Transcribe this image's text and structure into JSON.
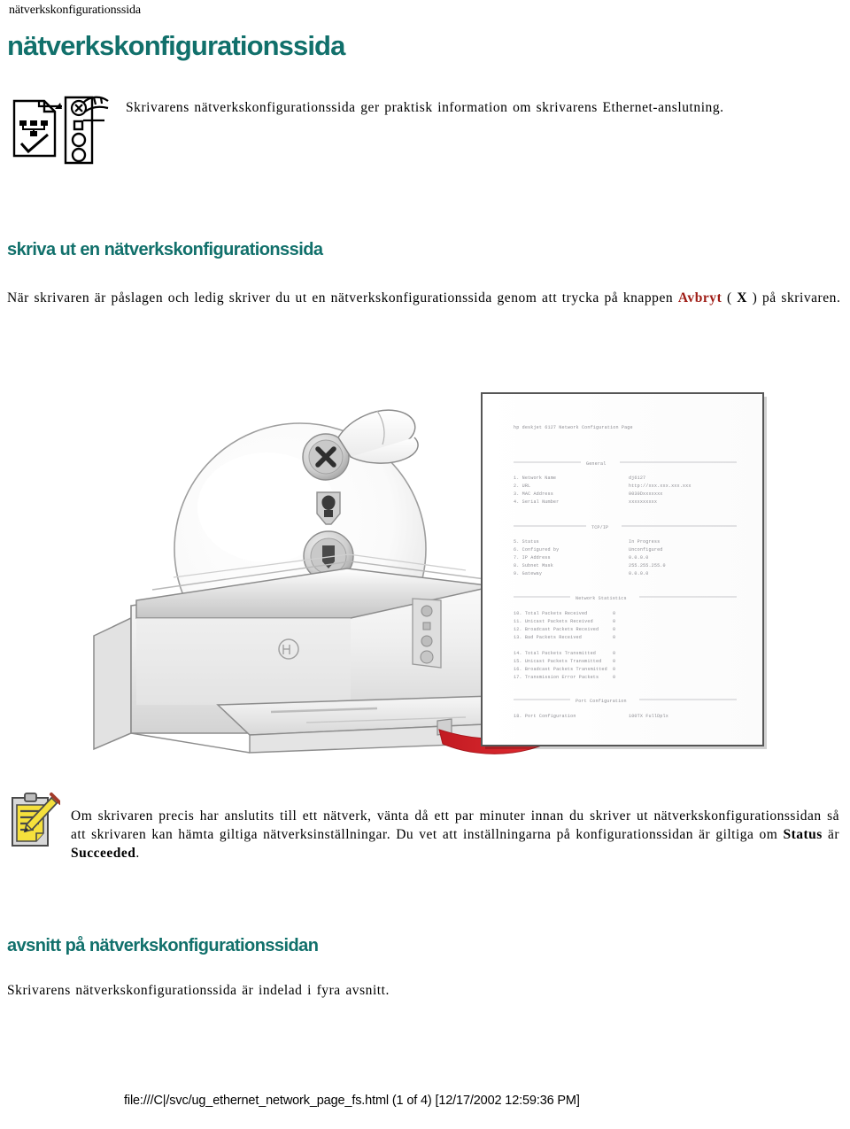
{
  "running_header": "nätverkskonfigurationssida",
  "doc_title": "nätverkskonfigurationssida",
  "intro": {
    "icon_name": "network-config-page-icon",
    "text": "Skrivarens nätverkskonfigurationssida ger praktisk information om skrivarens Ethernet-anslutning."
  },
  "print_section": {
    "heading": "skriva ut en nätverkskonfigurationssida",
    "text_part1": "När skrivaren är påslagen och ledig skriver du ut en nätverkskonfigurationssida genom att trycka på knappen ",
    "emphasis_button": "Avbryt",
    "text_part2": " ( ",
    "emphasis_symbol": "X",
    "text_part3": " ) på skrivaren."
  },
  "illustration": {
    "name": "printer-cancel-button-illustration",
    "callout_buttons": [
      {
        "name": "cancel-button",
        "glyph": "X",
        "label": "Avbryt"
      },
      {
        "name": "ink-status-icon",
        "glyph": "ink",
        "label": ""
      },
      {
        "name": "resume-button",
        "glyph": "page",
        "label": ""
      },
      {
        "name": "power-button",
        "glyph": "power",
        "label": ""
      }
    ],
    "arrow_color": "#d8262c",
    "printer_name": "hp deskjet printer"
  },
  "config_page": {
    "title": "hp deskjet 6127 Network Configuration Page",
    "sections": [
      {
        "name": "General",
        "rows": [
          {
            "num": "1.",
            "label": "Network Name",
            "value": "dj6127"
          },
          {
            "num": "2.",
            "label": "URL",
            "value": "http://xxx.xxx.xxx.xxx"
          },
          {
            "num": "3.",
            "label": "MAC Address",
            "value": "0030Dxxxxxxx"
          },
          {
            "num": "4.",
            "label": "Serial Number",
            "value": "xxxxxxxxxx"
          }
        ]
      },
      {
        "name": "TCP/IP",
        "rows": [
          {
            "num": "5.",
            "label": "Status",
            "value": "In Progress"
          },
          {
            "num": "6.",
            "label": "Configured by",
            "value": "Unconfigured"
          },
          {
            "num": "7.",
            "label": "IP Address",
            "value": "0.0.0.0"
          },
          {
            "num": "8.",
            "label": "Subnet Mask",
            "value": "255.255.255.0"
          },
          {
            "num": "9.",
            "label": "Gateway",
            "value": "0.0.0.0"
          }
        ]
      },
      {
        "name": "Network Statistics",
        "rows": [
          {
            "num": "10.",
            "label": "Total Packets Received",
            "value": "0"
          },
          {
            "num": "11.",
            "label": "Unicast Packets Received",
            "value": "0"
          },
          {
            "num": "12.",
            "label": "Broadcast Packets Received",
            "value": "0"
          },
          {
            "num": "13.",
            "label": "Bad Packets Received",
            "value": "0"
          },
          {
            "num": "14.",
            "label": "Total Packets Transmitted",
            "value": "0"
          },
          {
            "num": "15.",
            "label": "Unicast Packets Transmitted",
            "value": "0"
          },
          {
            "num": "16.",
            "label": "Broadcast Packets Transmitted",
            "value": "0"
          },
          {
            "num": "17.",
            "label": "Transmission Error Packets",
            "value": "0"
          }
        ]
      },
      {
        "name": "Port Configuration",
        "rows": [
          {
            "num": "18.",
            "label": "Port Configuration",
            "value": "100TX FullDplx"
          }
        ]
      }
    ]
  },
  "note": {
    "icon_name": "notepad-pencil-icon",
    "text_part1": "Om skrivaren precis har anslutits till ett nätverk, vänta då ett par minuter innan du skriver ut nätverkskonfigurationssidan så att skrivaren kan hämta giltiga nätverksinställningar. Du vet att inställningarna på konfigurationssidan är giltiga om ",
    "emphasis_status": "Status",
    "text_part2": " är ",
    "emphasis_succeeded": "Succeeded",
    "text_part3": "."
  },
  "parts_section": {
    "heading": "avsnitt på nätverkskonfigurationssidan",
    "text": "Skrivarens nätverkskonfigurationssida är indelad i fyra avsnitt."
  },
  "footer": "file:///C|/svc/ug_ethernet_network_page_fs.html (1 of 4) [12/17/2002 12:59:36 PM]",
  "colors": {
    "heading_teal": "#11706b",
    "emphasis_red": "#9e1b14",
    "arrow_red": "#d8262c",
    "note_icon_yellow": "#f5e03c"
  }
}
